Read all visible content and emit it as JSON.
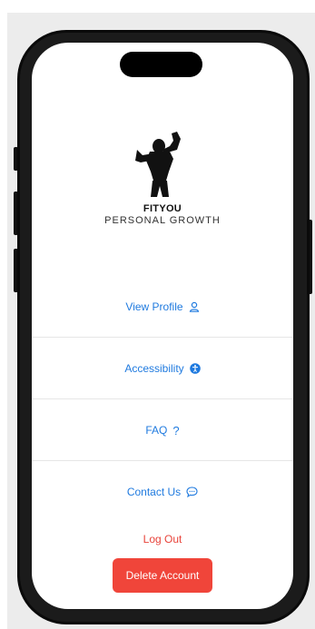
{
  "brand": {
    "name": "FITYOU",
    "tagline": "PERSONAL GROWTH"
  },
  "menu": {
    "view_profile": "View Profile",
    "accessibility": "Accessibility",
    "faq": "FAQ",
    "contact_us": "Contact Us"
  },
  "actions": {
    "logout": "Log Out",
    "delete_account": "Delete Account"
  },
  "icons": {
    "view_profile": "person-icon",
    "accessibility": "accessibility-icon",
    "faq": "question-mark-icon",
    "contact_us": "chat-bubble-icon"
  },
  "colors": {
    "link": "#1f7adf",
    "danger": "#f0453a",
    "logout_text": "#e8433a"
  }
}
